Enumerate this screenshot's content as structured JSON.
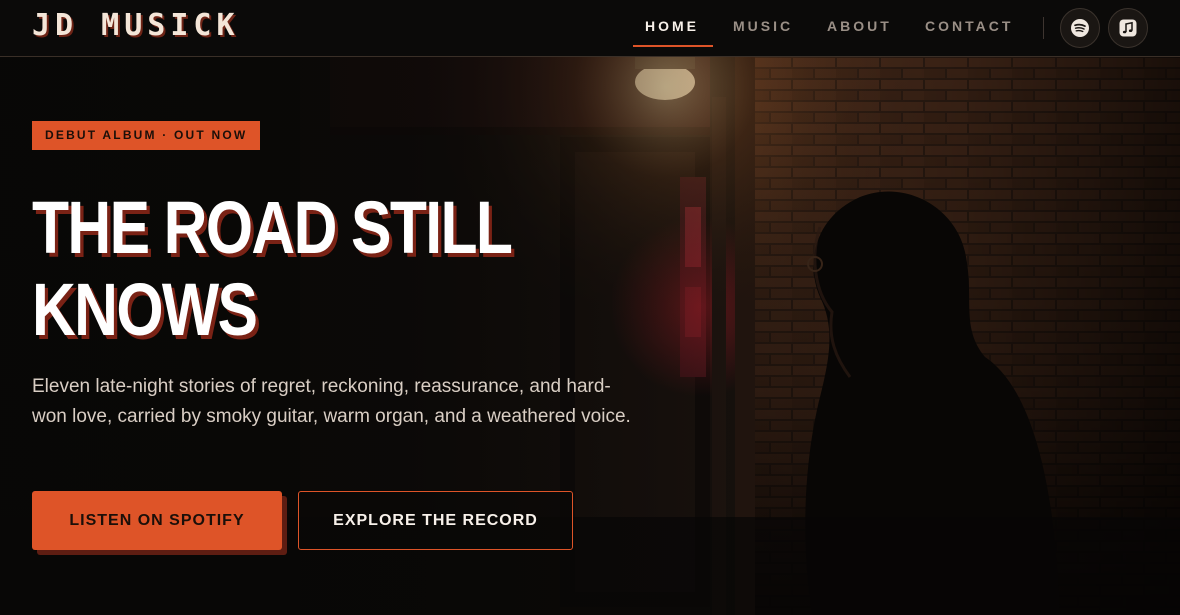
{
  "brand": {
    "name": "JD MUSICK"
  },
  "nav": {
    "items": [
      {
        "label": "HOME",
        "active": true
      },
      {
        "label": "MUSIC",
        "active": false
      },
      {
        "label": "ABOUT",
        "active": false
      },
      {
        "label": "CONTACT",
        "active": false
      }
    ],
    "icons": [
      {
        "name": "spotify-icon"
      },
      {
        "name": "apple-music-icon"
      }
    ]
  },
  "hero": {
    "badge": "DEBUT ALBUM · OUT NOW",
    "headline_line1": "THE ROAD STILL",
    "headline_line2": "KNOWS",
    "lede": "Eleven late-night stories of regret, reckoning, reassurance, and hard-won love, carried by smoky guitar, warm organ, and a weathered voice.",
    "primary_button": "LISTEN ON SPOTIFY",
    "secondary_button": "EXPLORE THE RECORD"
  },
  "colors": {
    "accent": "#de5428",
    "background": "#0b0a09",
    "text": "#f3ece4"
  }
}
